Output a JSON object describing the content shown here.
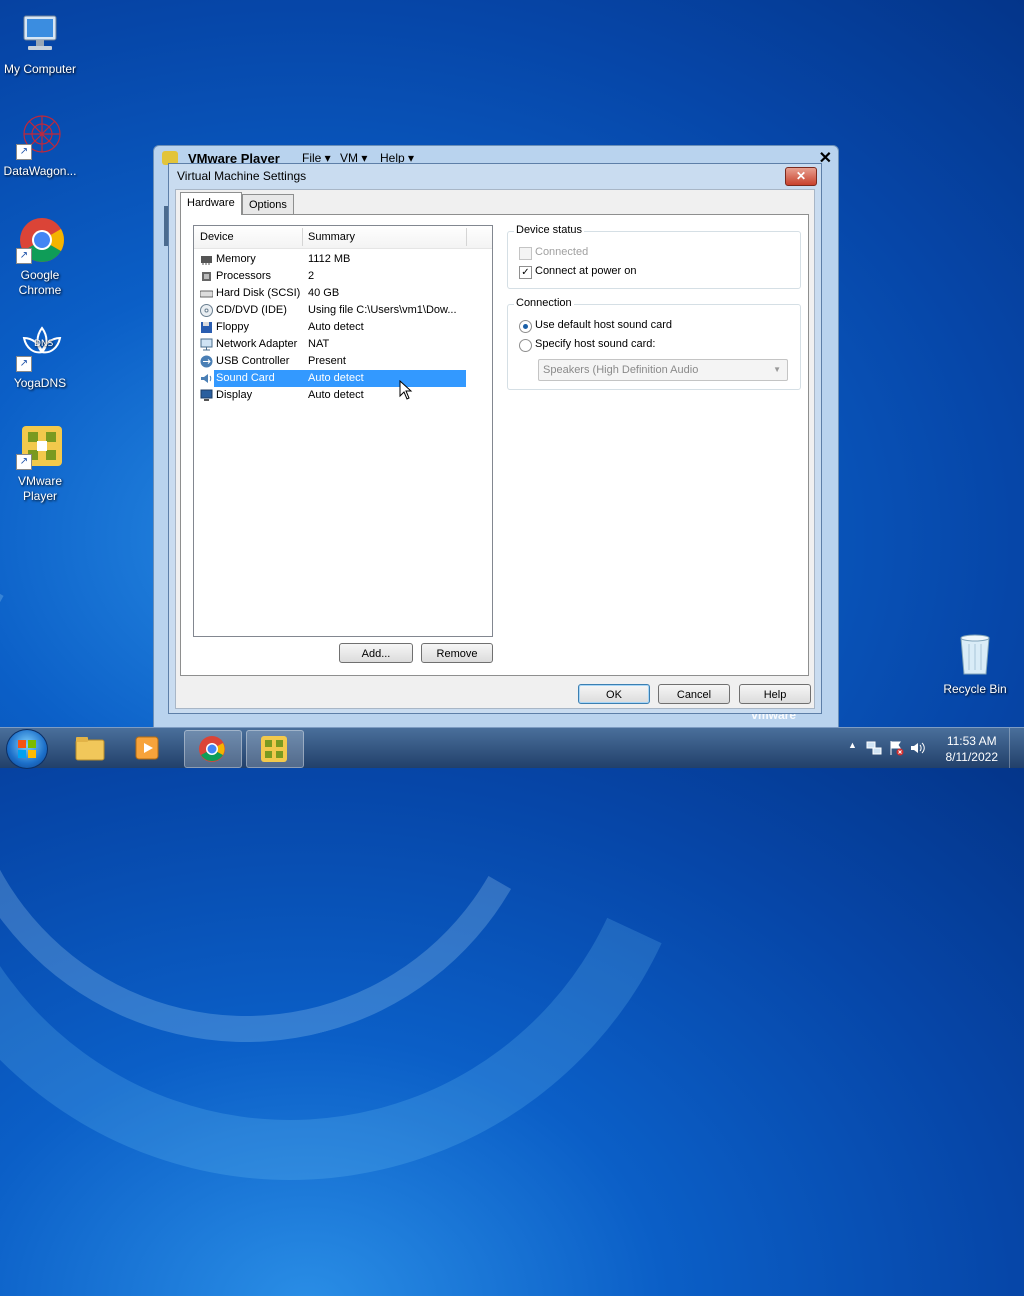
{
  "desktop": {
    "icons": [
      {
        "label": "My Computer",
        "icon": "computer-icon"
      },
      {
        "label": "DataWagon...",
        "icon": "datawagon-icon"
      },
      {
        "label": "Google Chrome",
        "icon": "chrome-icon"
      },
      {
        "label": "YogaDNS",
        "icon": "yogadns-icon"
      },
      {
        "label": "VMware Player",
        "icon": "vmware-icon"
      },
      {
        "label": "Recycle Bin",
        "icon": "recycle-bin-icon"
      }
    ]
  },
  "vmware": {
    "title": "VMware Player",
    "menus": [
      "File",
      "VM",
      "Help"
    ],
    "brand": "vmware"
  },
  "dialog": {
    "title": "Virtual Machine Settings",
    "tabs": [
      "Hardware",
      "Options"
    ],
    "columns": [
      "Device",
      "Summary"
    ],
    "devices": [
      {
        "name": "Memory",
        "summary": "1112 MB"
      },
      {
        "name": "Processors",
        "summary": "2"
      },
      {
        "name": "Hard Disk (SCSI)",
        "summary": "40 GB"
      },
      {
        "name": "CD/DVD (IDE)",
        "summary": "Using file C:\\Users\\vm1\\Dow..."
      },
      {
        "name": "Floppy",
        "summary": "Auto detect"
      },
      {
        "name": "Network Adapter",
        "summary": "NAT"
      },
      {
        "name": "USB Controller",
        "summary": "Present"
      },
      {
        "name": "Sound Card",
        "summary": "Auto detect"
      },
      {
        "name": "Display",
        "summary": "Auto detect"
      }
    ],
    "selected_device": "Sound Card",
    "add_label": "Add...",
    "remove_label": "Remove",
    "device_status": {
      "label": "Device status",
      "connected": "Connected",
      "connect_at_power_on": "Connect at power on"
    },
    "connection": {
      "label": "Connection",
      "use_default": "Use default host sound card",
      "specify": "Specify host sound card:",
      "sound_card_value": "Speakers (High Definition Audio"
    },
    "ok_label": "OK",
    "cancel_label": "Cancel",
    "help_label": "Help"
  },
  "taskbar": {
    "time": "11:53 AM",
    "date": "8/11/2022"
  }
}
